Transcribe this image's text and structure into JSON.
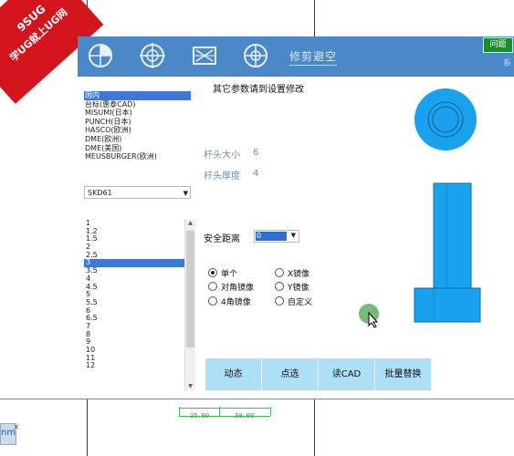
{
  "badge": {
    "line1": "9SUG",
    "line2": "学UG就上UG网"
  },
  "dialog": {
    "title": "修剪避空",
    "help_button": "问题",
    "right_char": "系",
    "hint": "其它参数请到设置修改",
    "standards": [
      "国内",
      "台标(惠泰CAD)",
      "MISUMI(日本)",
      "PUNCH(日本)",
      "HASCO(欧洲)",
      "DME(欧洲)",
      "DME(美国)",
      "MEUSBURGER(欧洲)"
    ],
    "standards_selected": 0,
    "material": "SKD61",
    "sizes": [
      "1",
      "1.2",
      "1.5",
      "2",
      "2.5",
      "3",
      "3.5",
      "4",
      "4.5",
      "5",
      "5.5",
      "6",
      "6.5",
      "7",
      "8",
      "9",
      "10",
      "11",
      "12"
    ],
    "sizes_selected": 5,
    "head_size_label": "杆头大小",
    "head_size_value": "6",
    "head_thickness_label": "杆头厚度",
    "head_thickness_value": "4",
    "safe_distance_label": "安全距离",
    "safe_distance_value": "0",
    "options": {
      "single": "单个",
      "x_mirror": "X镜像",
      "diagonal_mirror": "对角镜像",
      "y_mirror": "Y镜像",
      "four_corner_mirror": "4角镜像",
      "custom": "自定义",
      "selected": "single"
    },
    "buttons": {
      "dynamic": "动态",
      "point": "点选",
      "read_cad": "读CAD",
      "batch_replace": "批量替换"
    }
  },
  "cad": {
    "dim1": "25.00",
    "dim2": "30.00",
    "tab_text": "nm",
    "tab_close": "×"
  },
  "colors": {
    "toolbar": "#4a88c7",
    "part": "#1aa2ef",
    "button": "#ade0f7",
    "selection": "#3b78d8"
  },
  "icons": [
    "circle-quadrant-icon",
    "circle-cross-icon",
    "box-hourglass-icon",
    "circle-cross-small-icon"
  ]
}
